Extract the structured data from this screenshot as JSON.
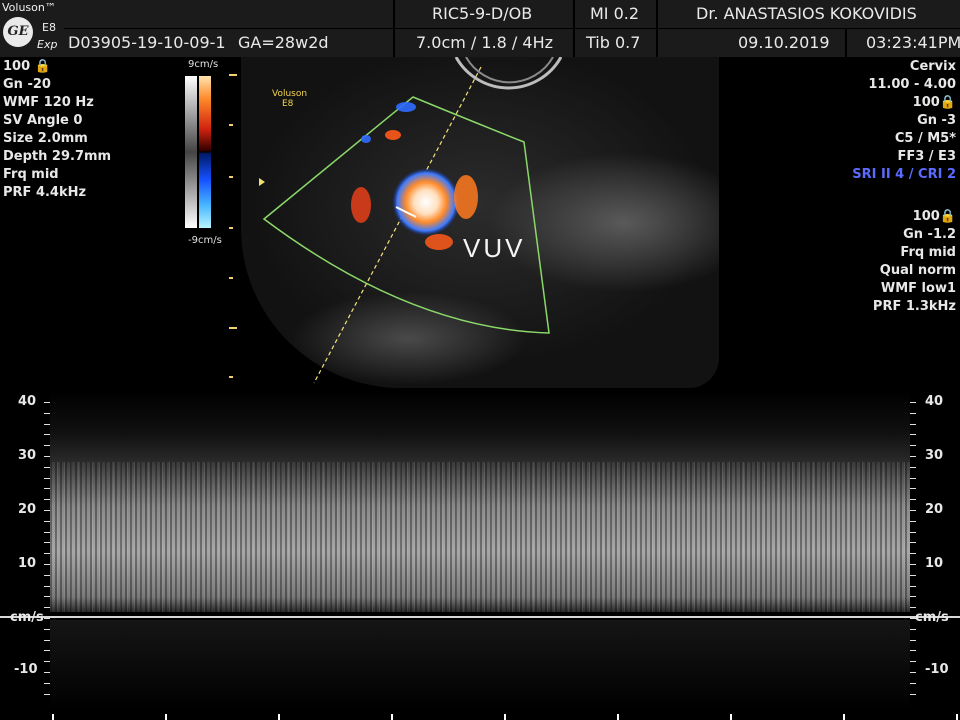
{
  "header": {
    "brand": "Voluson™",
    "logo_text": "GE",
    "model": "E8",
    "mode": "Exp",
    "probe": "RIC5-9-D/OB",
    "mi": "MI  0.2",
    "doctor": "Dr. ANASTASIOS KOKOVIDIS",
    "patient_id": "D03905-19-10-09-1",
    "gestational_age": "GA=28w2d",
    "depth_settings": "7.0cm / 1.8 /  4Hz",
    "tib": "Tib  0.7",
    "date": "09.10.2019",
    "time": "03:23:41PM"
  },
  "left_params": [
    "100 🔒",
    "Gn -20",
    "WMF 120 Hz",
    "SV Angle  0",
    "Size  2.0mm",
    "Depth 29.7mm",
    "Frq mid",
    "PRF  4.4kHz"
  ],
  "right_params": [
    "Cervix",
    "11.00 - 4.00",
    "100🔒",
    "Gn  -3",
    "C5 / M5*",
    "FF3 / E3"
  ],
  "right_params_blue": "SRI II 4 / CRI 2",
  "right_params_2": [
    "100🔒",
    "Gn -1.2",
    "Frq mid",
    "Qual norm",
    "WMF low1",
    "PRF  1.3kHz"
  ],
  "velocity_scale": {
    "top": "9cm/s",
    "bottom": "-9cm/s"
  },
  "image": {
    "watermark_brand": "Voluson",
    "watermark_model": "E8",
    "annotation": "VUV"
  },
  "spectral": {
    "ticks": [
      "40",
      "30",
      "20",
      "10",
      "-10"
    ],
    "unit": "cm/s"
  },
  "colors": {
    "header_bg": "#1b1b1b",
    "sector_outline": "#8bd86a",
    "cursor_line": "#f2e27a",
    "label_blue": "#5b6bff"
  }
}
